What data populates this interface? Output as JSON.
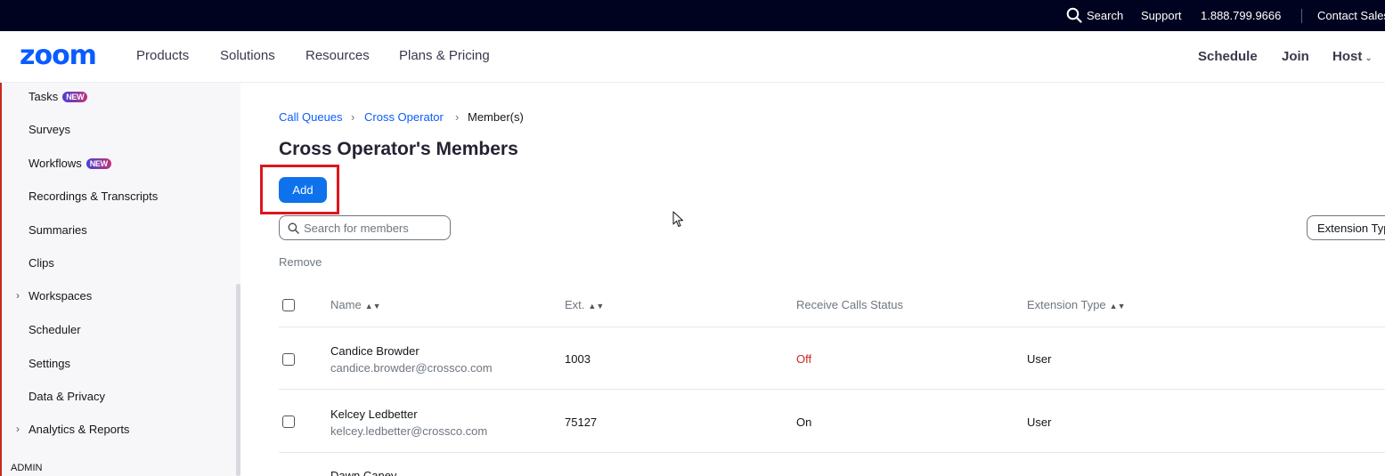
{
  "utility_bar": {
    "search_label": "Search",
    "support_label": "Support",
    "phone": "1.888.799.9666",
    "contact_sales": "Contact Sales"
  },
  "nav": {
    "logo_text": "zoom",
    "links": [
      "Products",
      "Solutions",
      "Resources",
      "Plans & Pricing"
    ],
    "right_links": [
      "Schedule",
      "Join",
      "Host"
    ]
  },
  "sidebar": {
    "items": [
      {
        "label": "Tasks",
        "badge": "NEW"
      },
      {
        "label": "Surveys"
      },
      {
        "label": "Workflows",
        "badge": "NEW"
      },
      {
        "label": "Recordings & Transcripts"
      },
      {
        "label": "Summaries"
      },
      {
        "label": "Clips"
      },
      {
        "label": "Workspaces",
        "expandable": true
      },
      {
        "label": "Scheduler"
      },
      {
        "label": "Settings"
      },
      {
        "label": "Data & Privacy"
      },
      {
        "label": "Analytics & Reports",
        "expandable": true
      }
    ],
    "section_admin": "ADMIN"
  },
  "breadcrumb": [
    "Call Queues",
    "Cross Operator",
    "Member(s)"
  ],
  "page_title": "Cross Operator's Members",
  "add_button": "Add",
  "search": {
    "placeholder": "Search for members",
    "value": ""
  },
  "extension_filter": "Extension Type",
  "remove_label": "Remove",
  "table": {
    "headers": [
      "Name",
      "Ext.",
      "Receive Calls Status",
      "Extension Type"
    ],
    "rows": [
      {
        "name": "Candice Browder",
        "email": "candice.browder@crossco.com",
        "ext": "1003",
        "status": "Off",
        "type": "User"
      },
      {
        "name": "Kelcey Ledbetter",
        "email": "kelcey.ledbetter@crossco.com",
        "ext": "75127",
        "status": "On",
        "type": "User"
      },
      {
        "name": "Dawn Caney"
      }
    ]
  },
  "colors": {
    "brand": "#0b5cff",
    "primary_button": "#0e72ed",
    "status_off": "#c8281e",
    "highlight": "#e0151b",
    "utility_bar": "#00031f"
  }
}
